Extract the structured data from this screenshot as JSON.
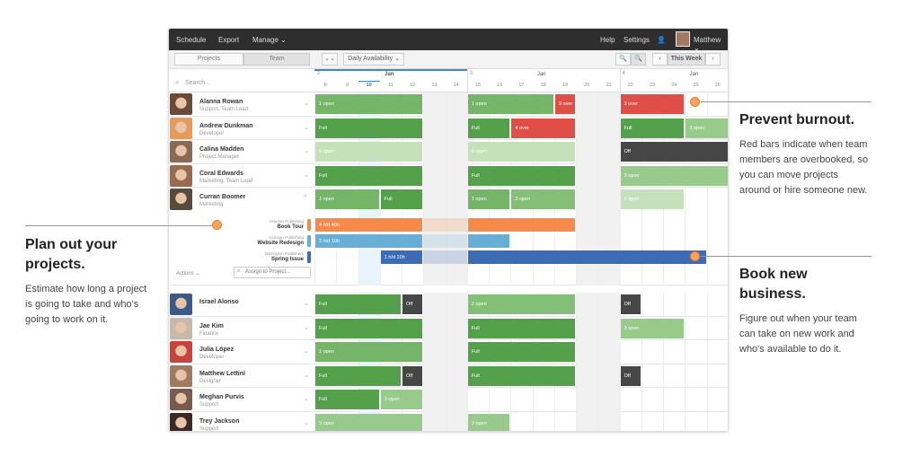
{
  "nav": {
    "schedule": "Schedule",
    "export": "Export",
    "manage": "Manage ⌄",
    "help": "Help",
    "settings": "Settings",
    "user": "Matthew ⌄"
  },
  "toolbar": {
    "projects": "Projects",
    "team": "Team",
    "collapse": "⌄⌄",
    "view": "Daily Availability ⌄",
    "this_week": "This Week",
    "prev": "‹",
    "next": "›"
  },
  "search_placeholder": "Search...",
  "weeks": [
    {
      "num": "2",
      "month": "Jan"
    },
    {
      "num": "3",
      "month": "Jan"
    },
    {
      "num": "4",
      "month": "Jan"
    }
  ],
  "days": [
    "8",
    "9",
    "10",
    "11",
    "12",
    "13",
    "14",
    "15",
    "16",
    "17",
    "18",
    "19",
    "20",
    "21",
    "22",
    "23",
    "24",
    "25",
    "26"
  ],
  "today_day": "10",
  "weekend_days": [
    "13",
    "14",
    "20",
    "21"
  ],
  "colors": {
    "full": "#55a14b",
    "open1": "#74b567",
    "open2": "#84bf77",
    "open3": "#97ca8b",
    "open6": "#c4e1bc",
    "over": "#df4f48",
    "off": "#474747",
    "orange": "#f7894a",
    "lightblue": "#68afd8",
    "blue": "#3c6db4",
    "accent": "#ef7e2e"
  },
  "people": [
    {
      "name": "Alanna Rowan",
      "role": "Support, Team Lead",
      "avatar": "#6b4a3a",
      "bars": [
        [
          "8",
          "12",
          "1 open",
          "open1"
        ],
        [
          "15",
          "18",
          "1 open",
          "open1"
        ],
        [
          "19",
          "19",
          "3 over",
          "over"
        ],
        [
          "22",
          "24",
          "3 over",
          "over"
        ]
      ]
    },
    {
      "name": "Andrew Dunkman",
      "role": "Developer",
      "avatar": "#e89a5a",
      "bars": [
        [
          "8",
          "12",
          "Full",
          "full"
        ],
        [
          "15",
          "16",
          "Full",
          "full"
        ],
        [
          "17",
          "19",
          "4 over",
          "over"
        ],
        [
          "22",
          "24",
          "Full",
          "full"
        ],
        [
          "25",
          "26",
          "3 open",
          "open3"
        ]
      ]
    },
    {
      "name": "Calina Madden",
      "role": "Project Manager",
      "avatar": "#8a6a55",
      "bars": [
        [
          "8",
          "12",
          "6 open",
          "open6"
        ],
        [
          "15",
          "19",
          "6 open",
          "open6"
        ],
        [
          "22",
          "26",
          "Off",
          "off"
        ]
      ]
    },
    {
      "name": "Coral Edwards",
      "role": "Marketing, Team Lead",
      "avatar": "#9a6a50",
      "bars": [
        [
          "8",
          "12",
          "Full",
          "full"
        ],
        [
          "15",
          "19",
          "Full",
          "full"
        ],
        [
          "22",
          "26",
          "3 open",
          "open3"
        ]
      ]
    },
    {
      "name": "Curran Boomer",
      "role": "Marketing",
      "avatar": "#5a4a3a",
      "expanded": true,
      "bars": [
        [
          "8",
          "10",
          "1 open",
          "open1"
        ],
        [
          "11",
          "12",
          "Full",
          "full"
        ],
        [
          "15",
          "16",
          "1 open",
          "open1"
        ],
        [
          "17",
          "19",
          "2 open",
          "open2"
        ],
        [
          "22",
          "24",
          "6 open",
          "open6"
        ]
      ],
      "projects": [
        {
          "client": "Astorian Publishing",
          "name": "Book Tour",
          "color": "orange",
          "bars": [
            [
              "8",
              "12",
              "4 h/d  40h"
            ],
            [
              "15",
              "19",
              ""
            ]
          ],
          "gap": [
            "13",
            "14"
          ]
        },
        {
          "client": "Astorian Publishing",
          "name": "Website Redesign",
          "color": "lightblue",
          "bars": [
            [
              "8",
              "12",
              "2 h/d  10h"
            ],
            [
              "15",
              "16",
              ""
            ]
          ],
          "gap": [
            "13",
            "14"
          ]
        },
        {
          "client": "Barrington Publishers",
          "name": "Spring Issue",
          "color": "blue",
          "bars": [
            [
              "11",
              "12",
              "1 h/d  10h"
            ],
            [
              "15",
              "25",
              ""
            ]
          ],
          "gap": [
            "13",
            "14"
          ]
        }
      ],
      "actions": "Actions ⌄",
      "assign_placeholder": "Assign to Project..."
    },
    {
      "name": "Israel Alonso",
      "role": "",
      "avatar": "#3a5a8a",
      "bars": [
        [
          "8",
          "11",
          "Full",
          "full"
        ],
        [
          "12",
          "12",
          "Off",
          "off"
        ],
        [
          "15",
          "19",
          "2 open",
          "open2"
        ],
        [
          "22",
          "22",
          "Off",
          "off"
        ]
      ]
    },
    {
      "name": "Jae Kim",
      "role": "Finance",
      "avatar": "#c9b9a9",
      "bars": [
        [
          "8",
          "12",
          "Full",
          "full"
        ],
        [
          "15",
          "19",
          "Full",
          "full"
        ],
        [
          "22",
          "24",
          "3 open",
          "open3"
        ]
      ]
    },
    {
      "name": "Julia López",
      "role": "Developer",
      "avatar": "#c9433a",
      "bars": [
        [
          "8",
          "12",
          "1 open",
          "open1"
        ],
        [
          "15",
          "19",
          "Full",
          "full"
        ]
      ]
    },
    {
      "name": "Matthew Lettini",
      "role": "Designer",
      "avatar": "#a07a60",
      "bars": [
        [
          "8",
          "11",
          "Full",
          "full"
        ],
        [
          "12",
          "12",
          "Off",
          "off"
        ],
        [
          "15",
          "19",
          "Full",
          "full"
        ],
        [
          "22",
          "22",
          "Off",
          "off"
        ]
      ]
    },
    {
      "name": "Meghan Purvis",
      "role": "Support",
      "avatar": "#7a5a4a",
      "bars": [
        [
          "8",
          "10",
          "Full",
          "full"
        ],
        [
          "11",
          "12",
          "3 open",
          "open3"
        ]
      ]
    },
    {
      "name": "Trey Jackson",
      "role": "Support",
      "avatar": "#3a2a22",
      "bars": [
        [
          "8",
          "12",
          "3 open",
          "open3"
        ],
        [
          "15",
          "16",
          "3 open",
          "open3"
        ]
      ]
    }
  ],
  "callouts": {
    "burnout": {
      "title": "Prevent burnout.",
      "text": "Red bars indicate when team members are overbooked, so you can move projects around or hire someone new."
    },
    "plan": {
      "title": "Plan out your projects.",
      "text": "Estimate how long a project is going to take and who's going to work on it."
    },
    "book": {
      "title": "Book new business.",
      "text": "Figure out when your team can take on new work and who's available to do it."
    }
  }
}
